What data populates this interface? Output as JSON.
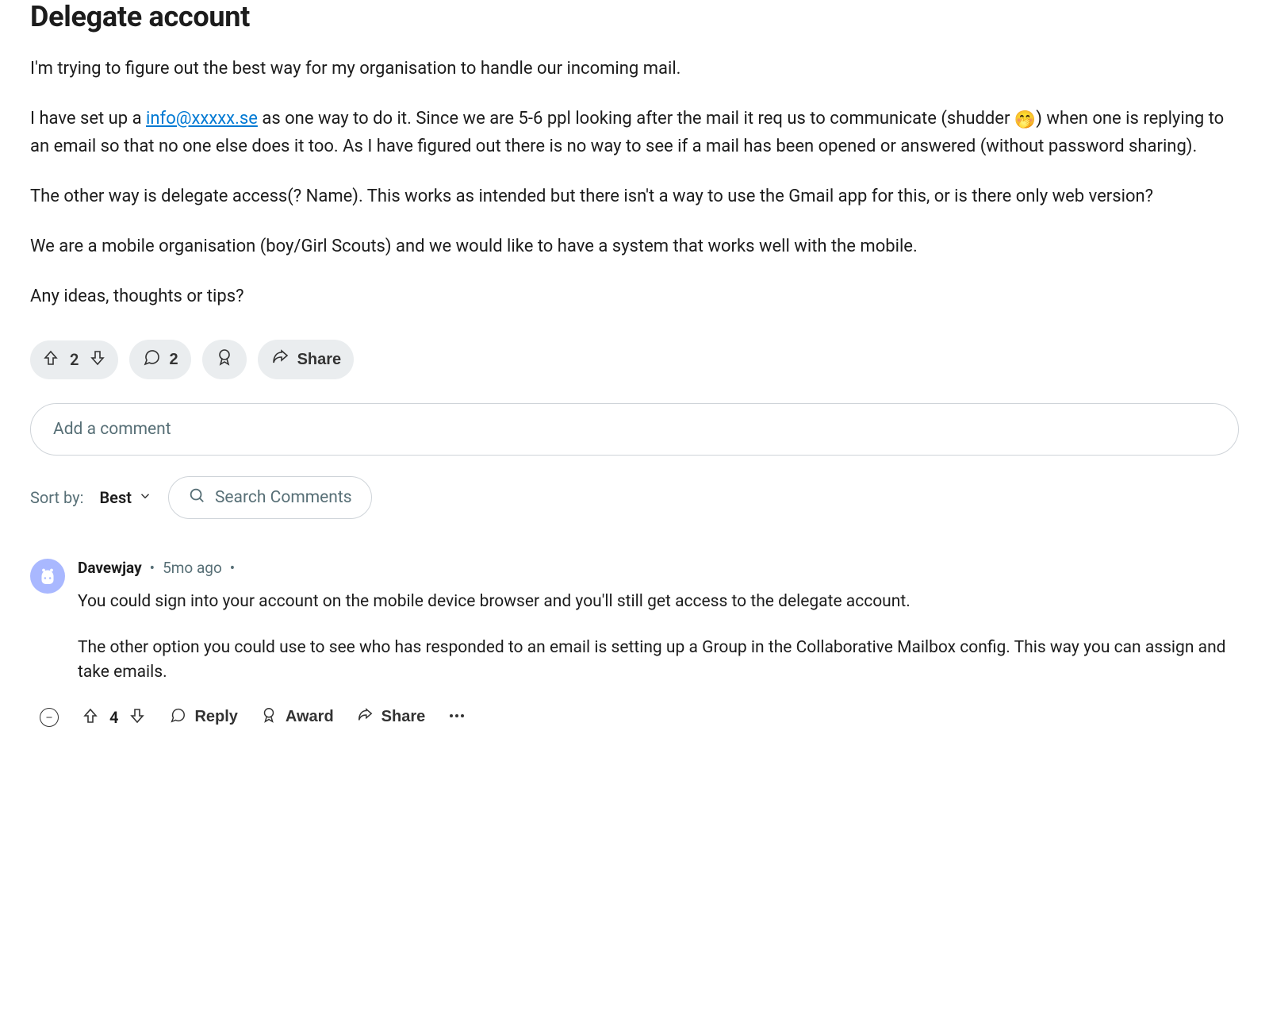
{
  "post": {
    "title": "Delegate account",
    "para1": "I'm trying to figure out the best way for my organisation to handle our incoming mail.",
    "para2_a": "I have set up a ",
    "para2_link": "info@xxxxx.se",
    "para2_b": " as one way to do it. Since we are 5-6 ppl looking after the mail it req us to communicate (shudder ",
    "para2_emoji": "🤭",
    "para2_c": ") when one is replying to an email so that no one else does it too. As I have figured out there is no way to see if a mail has been opened or answered (without password sharing).",
    "para3": "The other way is delegate access(? Name). This works as intended but there isn't a way to use the Gmail app for this, or is there only web version?",
    "para4": "We are a mobile organisation (boy/Girl Scouts) and we would like to have a system that works well with the mobile.",
    "para5": "Any ideas, thoughts or tips?"
  },
  "actions": {
    "score": "2",
    "comments": "2",
    "share": "Share"
  },
  "comment_input": {
    "placeholder": "Add a comment"
  },
  "sort": {
    "label": "Sort by:",
    "selected": "Best",
    "search_placeholder": "Search Comments"
  },
  "comments": [
    {
      "author": "Davewjay",
      "time": "5mo ago",
      "body1": "You could sign into your account on the mobile device browser and you'll still get access to the delegate account.",
      "body2": "The other option you could use to see who has responded to an email is setting up a Group in the Collaborative Mailbox config. This way you can assign and take emails.",
      "score": "4",
      "reply": "Reply",
      "award": "Award",
      "share": "Share"
    }
  ]
}
